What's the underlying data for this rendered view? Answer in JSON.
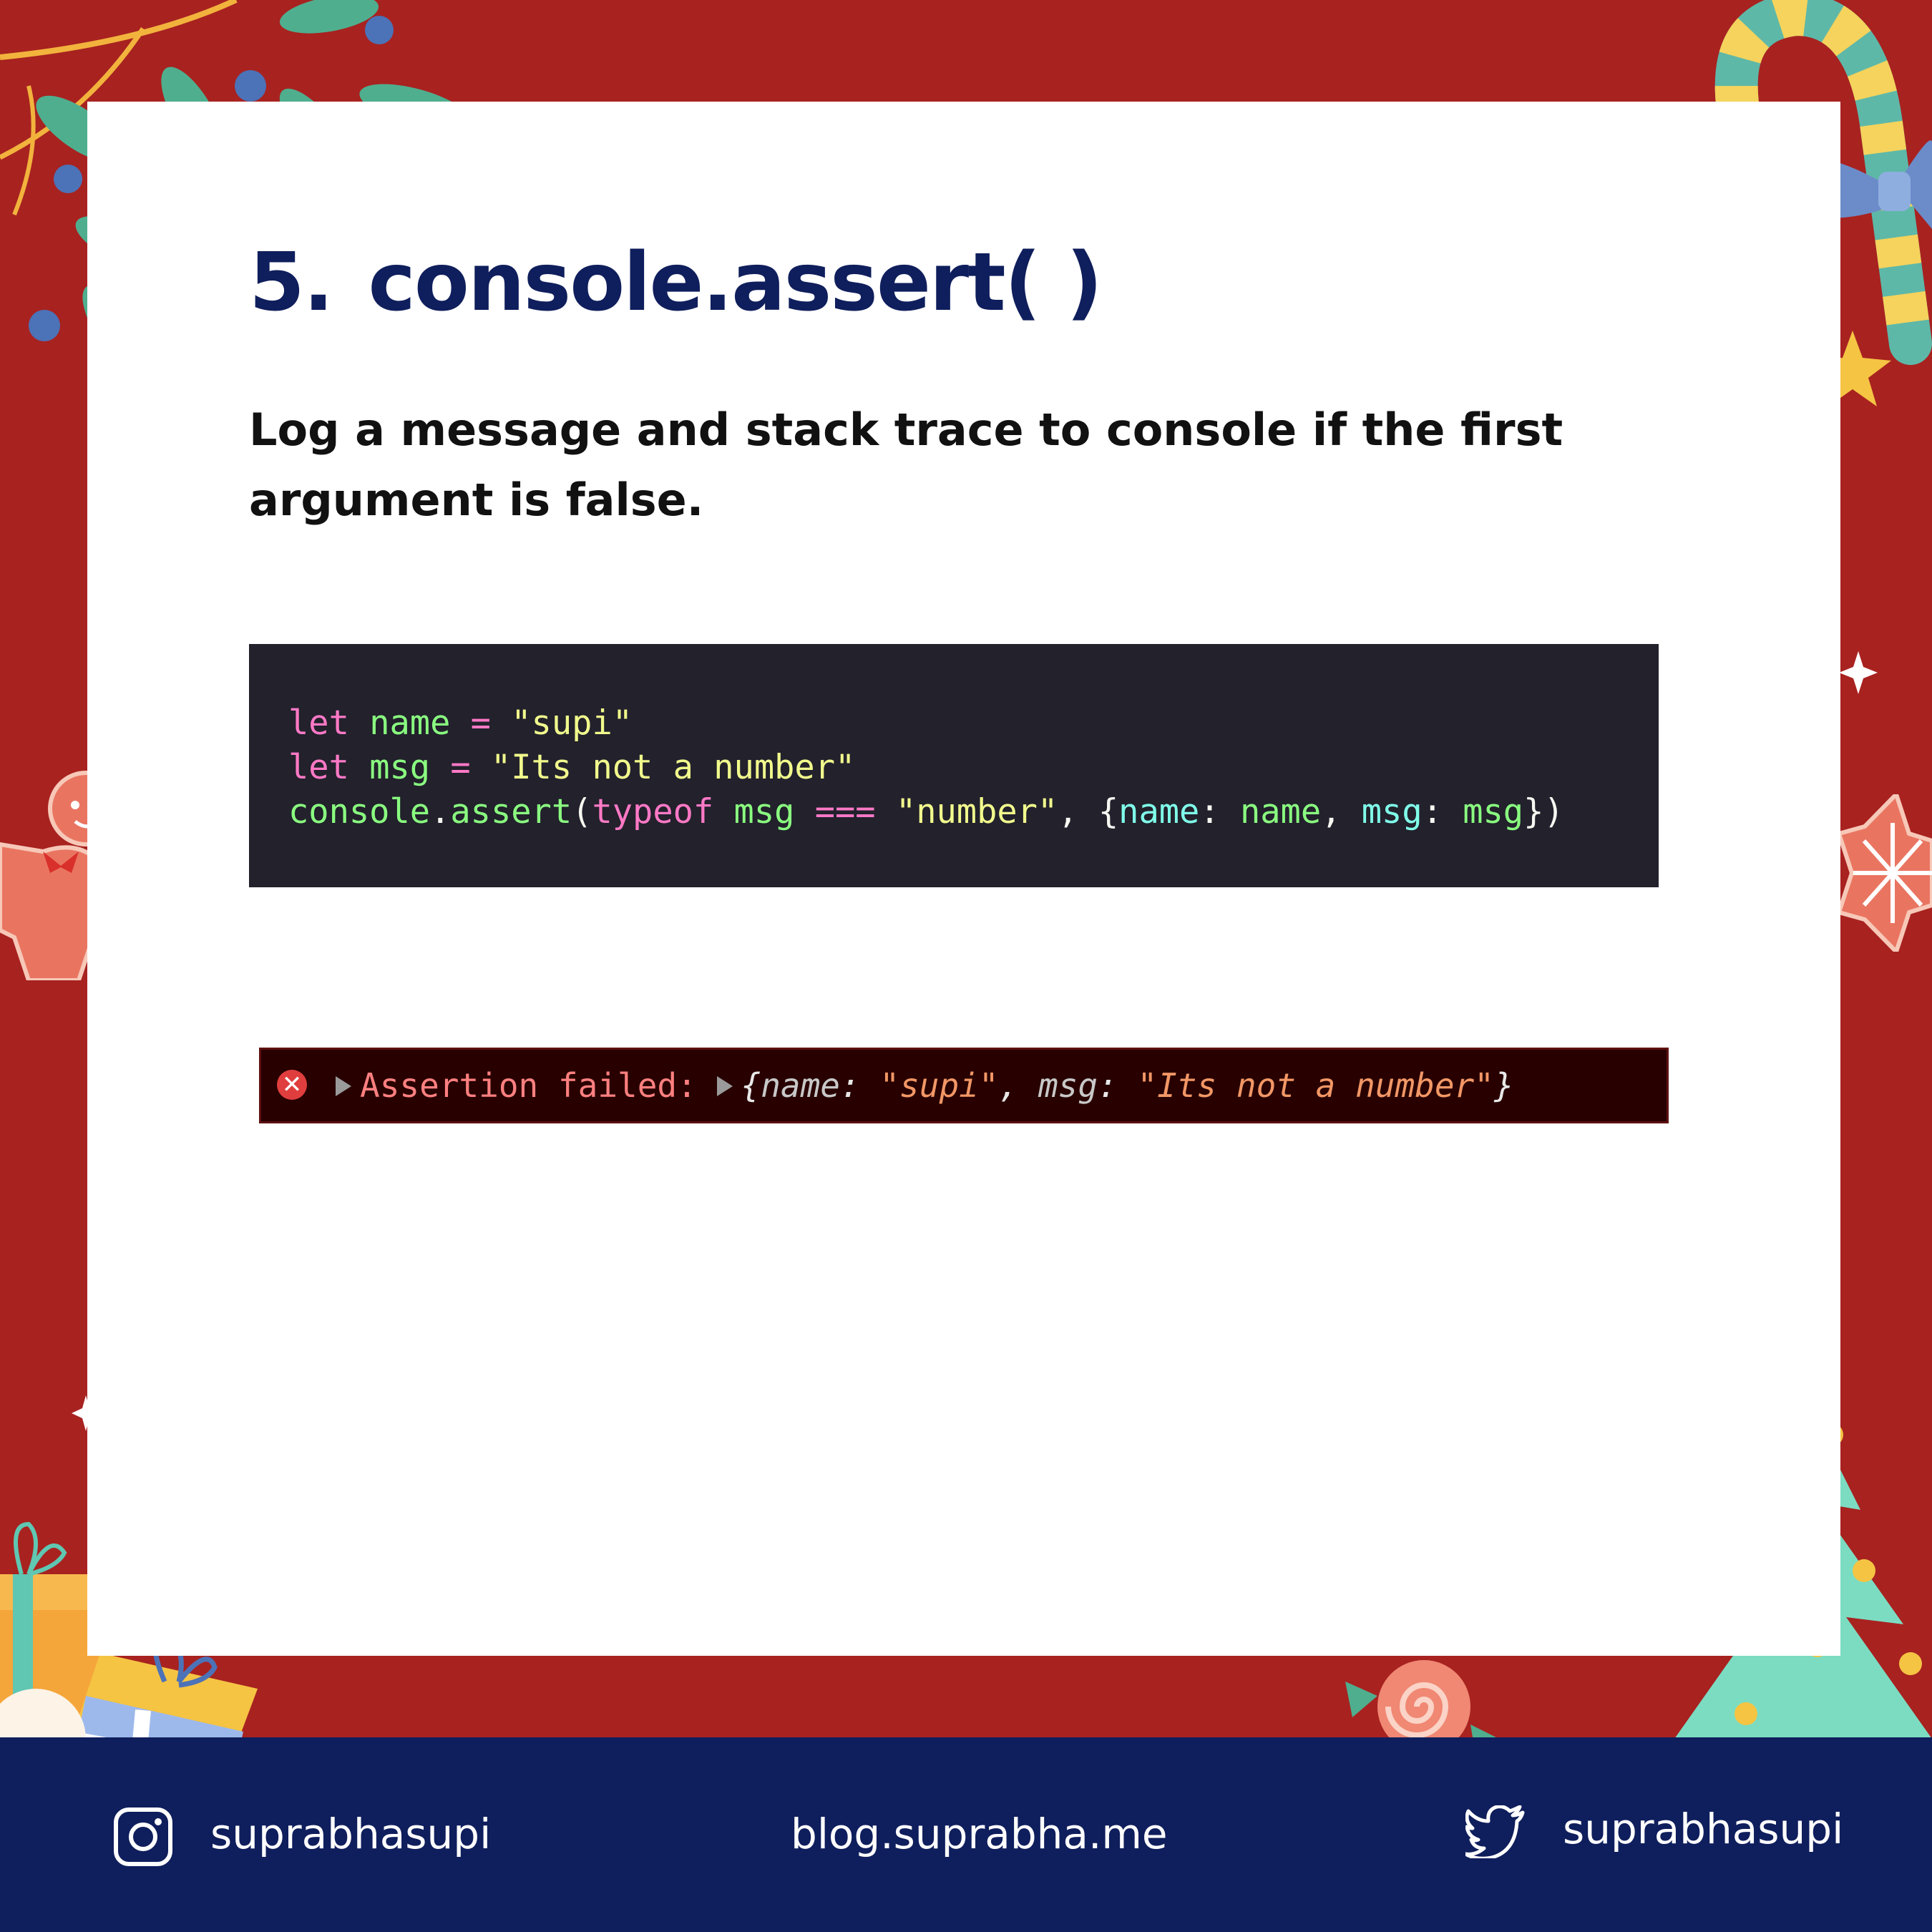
{
  "slide": {
    "number": "5.",
    "title": "console.assert( )",
    "subtitle": "Log a message and stack trace to console if the first argument is false."
  },
  "code_block": {
    "lines": [
      [
        {
          "t": "let",
          "c": "kw"
        },
        {
          "t": " ",
          "c": "punct"
        },
        {
          "t": "name",
          "c": "var"
        },
        {
          "t": " = ",
          "c": "op"
        },
        {
          "t": "\"supi\"",
          "c": "str"
        }
      ],
      [
        {
          "t": "let",
          "c": "kw"
        },
        {
          "t": " ",
          "c": "punct"
        },
        {
          "t": "msg",
          "c": "var"
        },
        {
          "t": " = ",
          "c": "op"
        },
        {
          "t": "\"Its not a number\"",
          "c": "str"
        }
      ],
      [
        {
          "t": "console",
          "c": "var"
        },
        {
          "t": ".",
          "c": "punct"
        },
        {
          "t": "assert",
          "c": "var"
        },
        {
          "t": "(",
          "c": "punct"
        },
        {
          "t": "typeof",
          "c": "kw"
        },
        {
          "t": " ",
          "c": "punct"
        },
        {
          "t": "msg",
          "c": "var"
        },
        {
          "t": " === ",
          "c": "op"
        },
        {
          "t": "\"number\"",
          "c": "str"
        },
        {
          "t": ", {",
          "c": "punct"
        },
        {
          "t": "name",
          "c": "prop"
        },
        {
          "t": ": ",
          "c": "punct"
        },
        {
          "t": "name",
          "c": "var"
        },
        {
          "t": ", ",
          "c": "punct"
        },
        {
          "t": "msg",
          "c": "prop"
        },
        {
          "t": ": ",
          "c": "punct"
        },
        {
          "t": "msg",
          "c": "var"
        },
        {
          "t": "})",
          "c": "punct"
        }
      ]
    ]
  },
  "console_error": {
    "icon": "error-x-icon",
    "label": "Assertion failed:",
    "obj_open": "{",
    "key1": "name",
    "sep": ": ",
    "val1": "\"supi\"",
    "comma": ", ",
    "key2": "msg",
    "val2": "\"Its not a number\"",
    "obj_close": "}"
  },
  "footer": {
    "instagram_handle": "suprabhasupi",
    "blog_url": "blog.suprabha.me",
    "twitter_handle": "suprabhasupi"
  },
  "colors": {
    "frame": "#A82220",
    "title": "#0F1E5C",
    "footer_bg": "#0F1E5C",
    "code_bg": "#22212C",
    "error_bg": "#280000"
  }
}
